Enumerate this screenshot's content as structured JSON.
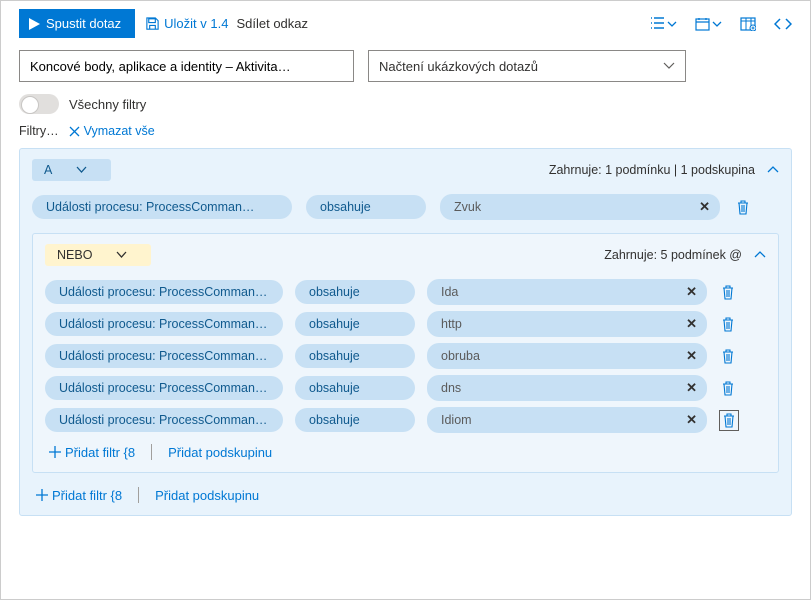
{
  "toolbar": {
    "run": "Spustit dotaz",
    "save": "Uložit v 1.4",
    "share": "Sdílet odkaz"
  },
  "inputs": {
    "scope": "Koncové body, aplikace a identity – Aktivita…",
    "samples": "Načtení ukázkových dotazů"
  },
  "filters": {
    "all_toggle": "Všechny filtry",
    "label": "Filtry…",
    "clear": "Vymazat vše",
    "add_filter": "Přidat filtr {8",
    "add_subgroup": "Přidat podskupinu"
  },
  "group": {
    "op": "A",
    "summary": "Zahrnuje: 1 podmínku | 1 podskupina",
    "cond": {
      "field": "Události procesu: ProcessComman…",
      "operator": "obsahuje",
      "value": "Zvuk"
    }
  },
  "subgroup": {
    "op": "NEBO",
    "summary": "Zahrnuje: 5 podmínek @",
    "rows": [
      {
        "field": "Události procesu: ProcessComman…",
        "operator": "obsahuje",
        "value": "Ida"
      },
      {
        "field": "Události procesu: ProcessComman…",
        "operator": "obsahuje",
        "value": "http"
      },
      {
        "field": "Události procesu: ProcessComman…",
        "operator": "obsahuje",
        "value": "obruba"
      },
      {
        "field": "Události procesu: ProcessComman…",
        "operator": "obsahuje",
        "value": "dns"
      },
      {
        "field": "Události procesu: ProcessComman…",
        "operator": "obsahuje",
        "value": "Idiom"
      }
    ]
  }
}
